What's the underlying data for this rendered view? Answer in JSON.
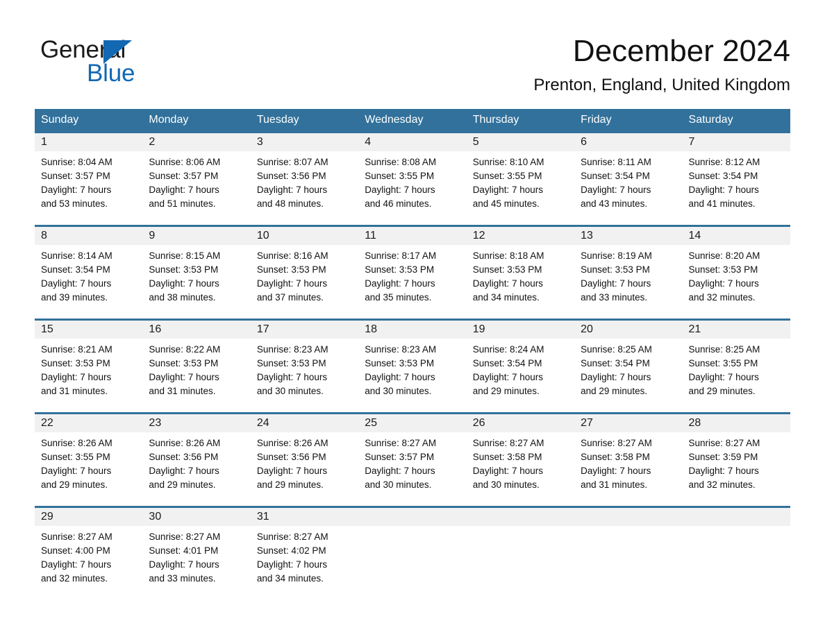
{
  "brand": {
    "name_part1": "General",
    "name_part2": "Blue",
    "triangle_icon": "blue-triangle-icon",
    "accent_color": "#1268b3"
  },
  "header": {
    "title": "December 2024",
    "location": "Prenton, England, United Kingdom"
  },
  "theme": {
    "header_blue": "#31719b",
    "date_band_gray": "#f1f1f1",
    "text_color": "#111111"
  },
  "weekday_headers": [
    "Sunday",
    "Monday",
    "Tuesday",
    "Wednesday",
    "Thursday",
    "Friday",
    "Saturday"
  ],
  "labels": {
    "sunrise_prefix": "Sunrise:",
    "sunset_prefix": "Sunset:",
    "daylight_prefix": "Daylight:"
  },
  "weeks": [
    [
      {
        "day": "1",
        "sunrise": "Sunrise: 8:04 AM",
        "sunset": "Sunset: 3:57 PM",
        "daylight_line1": "Daylight: 7 hours",
        "daylight_line2": "and 53 minutes."
      },
      {
        "day": "2",
        "sunrise": "Sunrise: 8:06 AM",
        "sunset": "Sunset: 3:57 PM",
        "daylight_line1": "Daylight: 7 hours",
        "daylight_line2": "and 51 minutes."
      },
      {
        "day": "3",
        "sunrise": "Sunrise: 8:07 AM",
        "sunset": "Sunset: 3:56 PM",
        "daylight_line1": "Daylight: 7 hours",
        "daylight_line2": "and 48 minutes."
      },
      {
        "day": "4",
        "sunrise": "Sunrise: 8:08 AM",
        "sunset": "Sunset: 3:55 PM",
        "daylight_line1": "Daylight: 7 hours",
        "daylight_line2": "and 46 minutes."
      },
      {
        "day": "5",
        "sunrise": "Sunrise: 8:10 AM",
        "sunset": "Sunset: 3:55 PM",
        "daylight_line1": "Daylight: 7 hours",
        "daylight_line2": "and 45 minutes."
      },
      {
        "day": "6",
        "sunrise": "Sunrise: 8:11 AM",
        "sunset": "Sunset: 3:54 PM",
        "daylight_line1": "Daylight: 7 hours",
        "daylight_line2": "and 43 minutes."
      },
      {
        "day": "7",
        "sunrise": "Sunrise: 8:12 AM",
        "sunset": "Sunset: 3:54 PM",
        "daylight_line1": "Daylight: 7 hours",
        "daylight_line2": "and 41 minutes."
      }
    ],
    [
      {
        "day": "8",
        "sunrise": "Sunrise: 8:14 AM",
        "sunset": "Sunset: 3:54 PM",
        "daylight_line1": "Daylight: 7 hours",
        "daylight_line2": "and 39 minutes."
      },
      {
        "day": "9",
        "sunrise": "Sunrise: 8:15 AM",
        "sunset": "Sunset: 3:53 PM",
        "daylight_line1": "Daylight: 7 hours",
        "daylight_line2": "and 38 minutes."
      },
      {
        "day": "10",
        "sunrise": "Sunrise: 8:16 AM",
        "sunset": "Sunset: 3:53 PM",
        "daylight_line1": "Daylight: 7 hours",
        "daylight_line2": "and 37 minutes."
      },
      {
        "day": "11",
        "sunrise": "Sunrise: 8:17 AM",
        "sunset": "Sunset: 3:53 PM",
        "daylight_line1": "Daylight: 7 hours",
        "daylight_line2": "and 35 minutes."
      },
      {
        "day": "12",
        "sunrise": "Sunrise: 8:18 AM",
        "sunset": "Sunset: 3:53 PM",
        "daylight_line1": "Daylight: 7 hours",
        "daylight_line2": "and 34 minutes."
      },
      {
        "day": "13",
        "sunrise": "Sunrise: 8:19 AM",
        "sunset": "Sunset: 3:53 PM",
        "daylight_line1": "Daylight: 7 hours",
        "daylight_line2": "and 33 minutes."
      },
      {
        "day": "14",
        "sunrise": "Sunrise: 8:20 AM",
        "sunset": "Sunset: 3:53 PM",
        "daylight_line1": "Daylight: 7 hours",
        "daylight_line2": "and 32 minutes."
      }
    ],
    [
      {
        "day": "15",
        "sunrise": "Sunrise: 8:21 AM",
        "sunset": "Sunset: 3:53 PM",
        "daylight_line1": "Daylight: 7 hours",
        "daylight_line2": "and 31 minutes."
      },
      {
        "day": "16",
        "sunrise": "Sunrise: 8:22 AM",
        "sunset": "Sunset: 3:53 PM",
        "daylight_line1": "Daylight: 7 hours",
        "daylight_line2": "and 31 minutes."
      },
      {
        "day": "17",
        "sunrise": "Sunrise: 8:23 AM",
        "sunset": "Sunset: 3:53 PM",
        "daylight_line1": "Daylight: 7 hours",
        "daylight_line2": "and 30 minutes."
      },
      {
        "day": "18",
        "sunrise": "Sunrise: 8:23 AM",
        "sunset": "Sunset: 3:53 PM",
        "daylight_line1": "Daylight: 7 hours",
        "daylight_line2": "and 30 minutes."
      },
      {
        "day": "19",
        "sunrise": "Sunrise: 8:24 AM",
        "sunset": "Sunset: 3:54 PM",
        "daylight_line1": "Daylight: 7 hours",
        "daylight_line2": "and 29 minutes."
      },
      {
        "day": "20",
        "sunrise": "Sunrise: 8:25 AM",
        "sunset": "Sunset: 3:54 PM",
        "daylight_line1": "Daylight: 7 hours",
        "daylight_line2": "and 29 minutes."
      },
      {
        "day": "21",
        "sunrise": "Sunrise: 8:25 AM",
        "sunset": "Sunset: 3:55 PM",
        "daylight_line1": "Daylight: 7 hours",
        "daylight_line2": "and 29 minutes."
      }
    ],
    [
      {
        "day": "22",
        "sunrise": "Sunrise: 8:26 AM",
        "sunset": "Sunset: 3:55 PM",
        "daylight_line1": "Daylight: 7 hours",
        "daylight_line2": "and 29 minutes."
      },
      {
        "day": "23",
        "sunrise": "Sunrise: 8:26 AM",
        "sunset": "Sunset: 3:56 PM",
        "daylight_line1": "Daylight: 7 hours",
        "daylight_line2": "and 29 minutes."
      },
      {
        "day": "24",
        "sunrise": "Sunrise: 8:26 AM",
        "sunset": "Sunset: 3:56 PM",
        "daylight_line1": "Daylight: 7 hours",
        "daylight_line2": "and 29 minutes."
      },
      {
        "day": "25",
        "sunrise": "Sunrise: 8:27 AM",
        "sunset": "Sunset: 3:57 PM",
        "daylight_line1": "Daylight: 7 hours",
        "daylight_line2": "and 30 minutes."
      },
      {
        "day": "26",
        "sunrise": "Sunrise: 8:27 AM",
        "sunset": "Sunset: 3:58 PM",
        "daylight_line1": "Daylight: 7 hours",
        "daylight_line2": "and 30 minutes."
      },
      {
        "day": "27",
        "sunrise": "Sunrise: 8:27 AM",
        "sunset": "Sunset: 3:58 PM",
        "daylight_line1": "Daylight: 7 hours",
        "daylight_line2": "and 31 minutes."
      },
      {
        "day": "28",
        "sunrise": "Sunrise: 8:27 AM",
        "sunset": "Sunset: 3:59 PM",
        "daylight_line1": "Daylight: 7 hours",
        "daylight_line2": "and 32 minutes."
      }
    ],
    [
      {
        "day": "29",
        "sunrise": "Sunrise: 8:27 AM",
        "sunset": "Sunset: 4:00 PM",
        "daylight_line1": "Daylight: 7 hours",
        "daylight_line2": "and 32 minutes."
      },
      {
        "day": "30",
        "sunrise": "Sunrise: 8:27 AM",
        "sunset": "Sunset: 4:01 PM",
        "daylight_line1": "Daylight: 7 hours",
        "daylight_line2": "and 33 minutes."
      },
      {
        "day": "31",
        "sunrise": "Sunrise: 8:27 AM",
        "sunset": "Sunset: 4:02 PM",
        "daylight_line1": "Daylight: 7 hours",
        "daylight_line2": "and 34 minutes."
      },
      {
        "day": "",
        "sunrise": "",
        "sunset": "",
        "daylight_line1": "",
        "daylight_line2": ""
      },
      {
        "day": "",
        "sunrise": "",
        "sunset": "",
        "daylight_line1": "",
        "daylight_line2": ""
      },
      {
        "day": "",
        "sunrise": "",
        "sunset": "",
        "daylight_line1": "",
        "daylight_line2": ""
      },
      {
        "day": "",
        "sunrise": "",
        "sunset": "",
        "daylight_line1": "",
        "daylight_line2": ""
      }
    ]
  ]
}
